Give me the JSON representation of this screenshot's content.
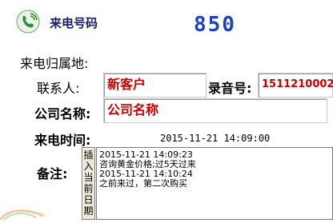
{
  "header": {
    "caller_label": "来电号码",
    "caller_number": "850"
  },
  "form": {
    "region_label": "来电归属地:",
    "contact_label": "联系人:",
    "contact_value": "新客户",
    "recording_label": "录音号:",
    "recording_value": "1511210002",
    "company_label": "公司名称:",
    "company_value": "公司名称",
    "time_label": "来电时间:",
    "time_value": "2015-11-21 14:09:00",
    "notes_label": "备注:",
    "insert_button": "插入当前日期"
  },
  "notes": [
    "2015-11-21 14:09:23",
    "咨询黄金价格;过5天过来",
    "2015-11-21 14:10:24",
    "之前来过，第二次购买"
  ],
  "colors": {
    "number": "#1f3fc4",
    "field_text": "#cc0000",
    "icon": "#2e8b2e"
  },
  "icons": {
    "phone": "phone-icon"
  }
}
